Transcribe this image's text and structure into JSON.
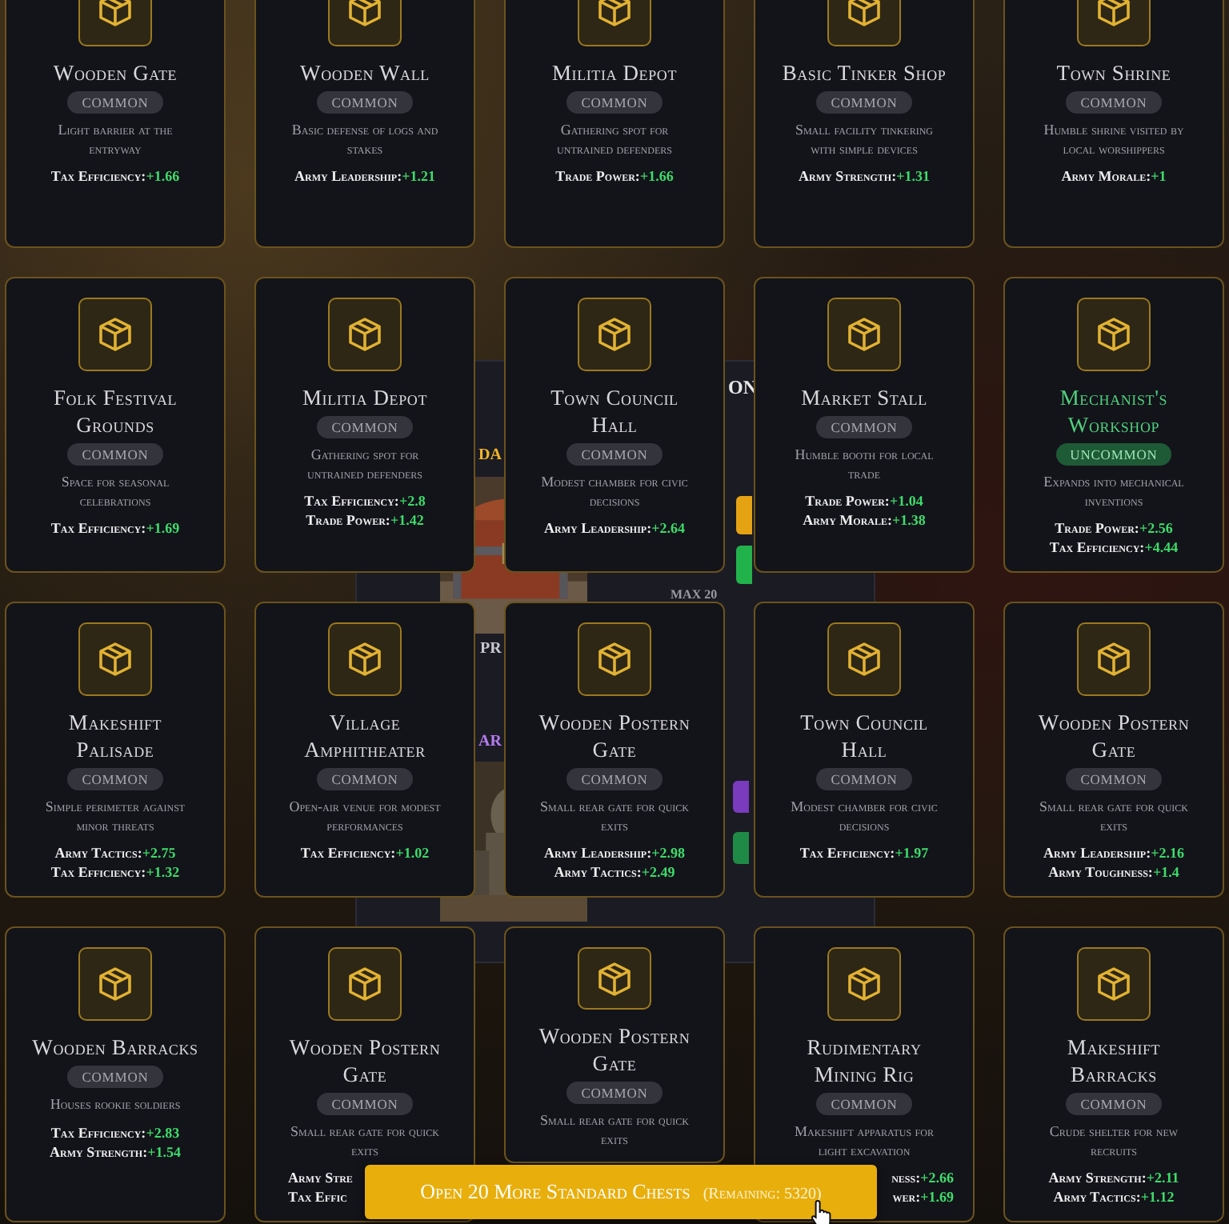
{
  "background_panel": {
    "fragments": [
      {
        "kind": "heading",
        "text": "ON"
      },
      {
        "kind": "gold",
        "text": "DA"
      },
      {
        "kind": "small",
        "text": "MAX 20"
      },
      {
        "kind": "price",
        "text": "PR"
      },
      {
        "kind": "purple",
        "text": "AR"
      }
    ],
    "buttons": [
      {
        "color": "#e5a213"
      },
      {
        "color": "#22b24c"
      },
      {
        "color": "#7a3bbf"
      },
      {
        "color": "#1f8a45"
      }
    ]
  },
  "cards": [
    {
      "name": "Wooden Gate",
      "rarity": "COMMON",
      "kind": "common",
      "description": "Light barrier at the entryway",
      "stats": [
        {
          "label": "Tax Efficiency:",
          "value": "+1.66"
        }
      ]
    },
    {
      "name": "Wooden Wall",
      "rarity": "COMMON",
      "kind": "common",
      "description": "Basic defense of logs and stakes",
      "stats": [
        {
          "label": "Army Leadership:",
          "value": "+1.21"
        }
      ]
    },
    {
      "name": "Militia Depot",
      "rarity": "COMMON",
      "kind": "common",
      "description": "Gathering spot for untrained defenders",
      "stats": [
        {
          "label": "Trade Power:",
          "value": "+1.66"
        }
      ]
    },
    {
      "name": "Basic Tinker Shop",
      "rarity": "COMMON",
      "kind": "common",
      "description": "Small facility tinkering with simple devices",
      "stats": [
        {
          "label": "Army Strength:",
          "value": "+1.31"
        }
      ]
    },
    {
      "name": "Town Shrine",
      "rarity": "COMMON",
      "kind": "common",
      "description": "Humble shrine visited by local worshippers",
      "stats": [
        {
          "label": "Army Morale:",
          "value": "+1"
        }
      ]
    },
    {
      "name": "Folk Festival Grounds",
      "rarity": "COMMON",
      "kind": "common",
      "description": "Space for seasonal celebrations",
      "stats": [
        {
          "label": "Tax Efficiency:",
          "value": "+1.69"
        }
      ]
    },
    {
      "name": "Militia Depot",
      "rarity": "COMMON",
      "kind": "common",
      "description": "Gathering spot for untrained defenders",
      "stats": [
        {
          "label": "Tax Efficiency:",
          "value": "+2.8"
        },
        {
          "label": "Trade Power:",
          "value": "+1.42"
        }
      ]
    },
    {
      "name": "Town Council Hall",
      "rarity": "COMMON",
      "kind": "common",
      "description": "Modest chamber for civic decisions",
      "stats": [
        {
          "label": "Army Leadership:",
          "value": "+2.64"
        }
      ]
    },
    {
      "name": "Market Stall",
      "rarity": "COMMON",
      "kind": "common",
      "description": "Humble booth for local trade",
      "stats": [
        {
          "label": "Trade Power:",
          "value": "+1.04"
        },
        {
          "label": "Army Morale:",
          "value": "+1.38"
        }
      ]
    },
    {
      "name": "Mechanist's Workshop",
      "rarity": "UNCOMMON",
      "kind": "uncommon",
      "description": "Expands into mechanical inventions",
      "stats": [
        {
          "label": "Trade Power:",
          "value": "+2.56"
        },
        {
          "label": "Tax Efficiency:",
          "value": "+4.44"
        }
      ]
    },
    {
      "name": "Makeshift Palisade",
      "rarity": "COMMON",
      "kind": "common",
      "description": "Simple perimeter against minor threats",
      "stats": [
        {
          "label": "Army Tactics:",
          "value": "+2.75"
        },
        {
          "label": "Tax Efficiency:",
          "value": "+1.32"
        }
      ]
    },
    {
      "name": "Village Amphitheater",
      "rarity": "COMMON",
      "kind": "common",
      "description": "Open-air venue for modest performances",
      "stats": [
        {
          "label": "Tax Efficiency:",
          "value": "+1.02"
        }
      ]
    },
    {
      "name": "Wooden Postern Gate",
      "rarity": "COMMON",
      "kind": "common",
      "description": "Small rear gate for quick exits",
      "stats": [
        {
          "label": "Army Leadership:",
          "value": "+2.98"
        },
        {
          "label": "Army Tactics:",
          "value": "+2.49"
        }
      ]
    },
    {
      "name": "Town Council Hall",
      "rarity": "COMMON",
      "kind": "common",
      "description": "Modest chamber for civic decisions",
      "stats": [
        {
          "label": "Tax Efficiency:",
          "value": "+1.97"
        }
      ]
    },
    {
      "name": "Wooden Postern Gate",
      "rarity": "COMMON",
      "kind": "common",
      "description": "Small rear gate for quick exits",
      "stats": [
        {
          "label": "Army Leadership:",
          "value": "+2.16"
        },
        {
          "label": "Army Toughness:",
          "value": "+1.4"
        }
      ]
    },
    {
      "name": "Wooden Barracks",
      "rarity": "COMMON",
      "kind": "common",
      "description": "Houses rookie soldiers",
      "stats": [
        {
          "label": "Tax Efficiency:",
          "value": "+2.83"
        },
        {
          "label": "Army Strength:",
          "value": "+1.54"
        }
      ]
    },
    {
      "name": "Wooden Postern Gate",
      "rarity": "COMMON",
      "kind": "common",
      "description": "Small rear gate for quick exits",
      "stats": [
        {
          "label": "Army Stre"
        },
        {
          "label": "Tax Effic"
        }
      ]
    },
    {
      "name": "Wooden Postern Gate",
      "rarity": "COMMON",
      "kind": "common",
      "description": "Small rear gate for quick exits"
    },
    {
      "name": "Rudimentary Mining Rig",
      "rarity": "COMMON",
      "kind": "common",
      "description": "Makeshift apparatus for light excavation",
      "stats": [
        {
          "label": "ness:",
          "value": "+2.66"
        },
        {
          "label": "wer:",
          "value": "+1.69"
        }
      ]
    },
    {
      "name": "Makeshift Barracks",
      "rarity": "COMMON",
      "kind": "common",
      "description": "Crude shelter for new recruits",
      "stats": [
        {
          "label": "Army Strength:",
          "value": "+2.11"
        },
        {
          "label": "Army Tactics:",
          "value": "+1.12"
        }
      ]
    }
  ],
  "open_button": {
    "label": "Open 20 More Standard Chests",
    "remaining": "(Remaining: 5320)"
  }
}
